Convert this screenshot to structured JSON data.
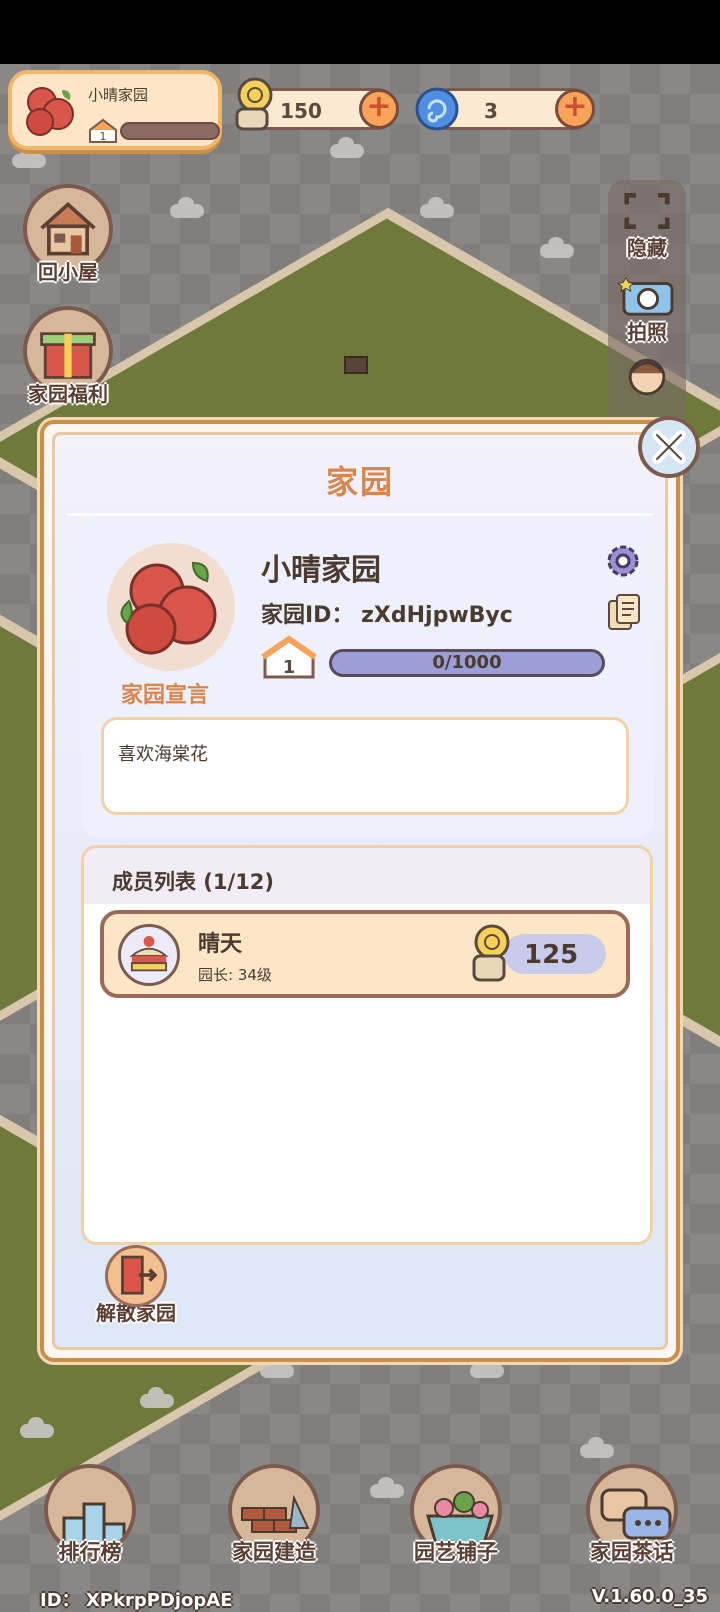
{
  "hud": {
    "garden_name": "小晴家园",
    "garden_level": "1",
    "snail_coins": "150",
    "spiral_gems": "3",
    "plus": "+"
  },
  "left_buttons": {
    "home": "回小屋",
    "benefits": "家园福利"
  },
  "right_panel": {
    "hide": "隐藏",
    "photo": "拍照"
  },
  "modal": {
    "title": "家园",
    "garden_name": "小晴家园",
    "garden_id": "家园ID：  zXdHjpwByc",
    "level": "1",
    "progress_text": "0/1000",
    "progress": 0.0,
    "declaration_label": "家园宣言",
    "declaration": "喜欢海棠花",
    "members_header": "成员列表 (1/12)",
    "members": [
      {
        "name": "晴天",
        "role": "园长: 34级",
        "score": "125"
      }
    ],
    "disband": "解散家园"
  },
  "bottom_nav": {
    "ranking": "排行榜",
    "build": "家园建造",
    "shop": "园艺铺子",
    "chat": "家园茶话"
  },
  "footer": {
    "player_id": "ID：  XPkrpPDjopAE",
    "version": "V.1.60.0_35"
  },
  "colors": {
    "accent": "#d9864e",
    "card": "#fde6c5",
    "border": "#7a5b4e"
  }
}
